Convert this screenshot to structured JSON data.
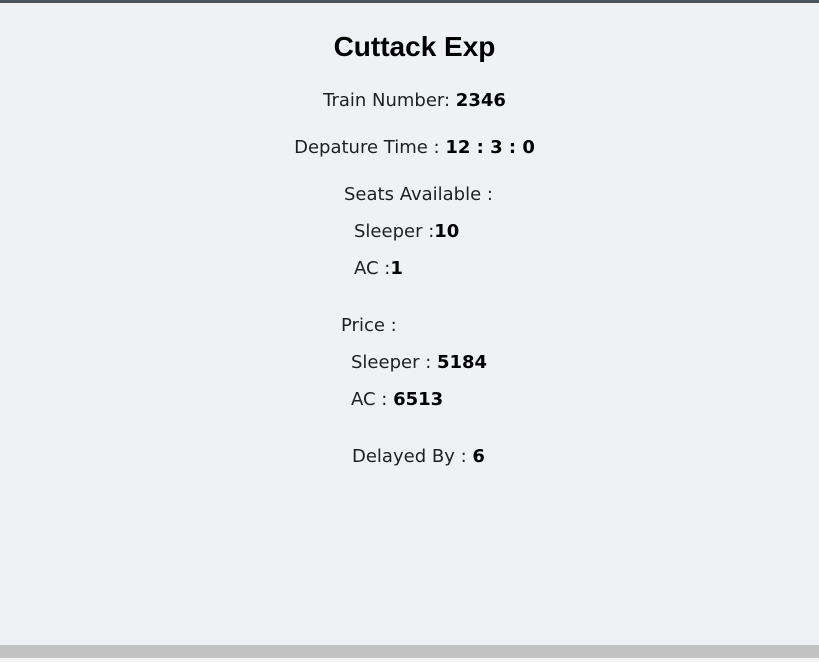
{
  "train": {
    "name": "Cuttack Exp",
    "number_label": "Train Number: ",
    "number": "2346",
    "departure_label": "Depature Time : ",
    "departure": "12 : 3 : 0"
  },
  "seats": {
    "heading": "Seats Available :",
    "sleeper_label": "Sleeper :",
    "sleeper": "10",
    "ac_label": "AC :",
    "ac": "1"
  },
  "price": {
    "heading": "Price :",
    "sleeper_label": "Sleeper : ",
    "sleeper": "5184",
    "ac_label": "AC : ",
    "ac": "6513"
  },
  "delay": {
    "label": "Delayed By : ",
    "value": "6"
  }
}
